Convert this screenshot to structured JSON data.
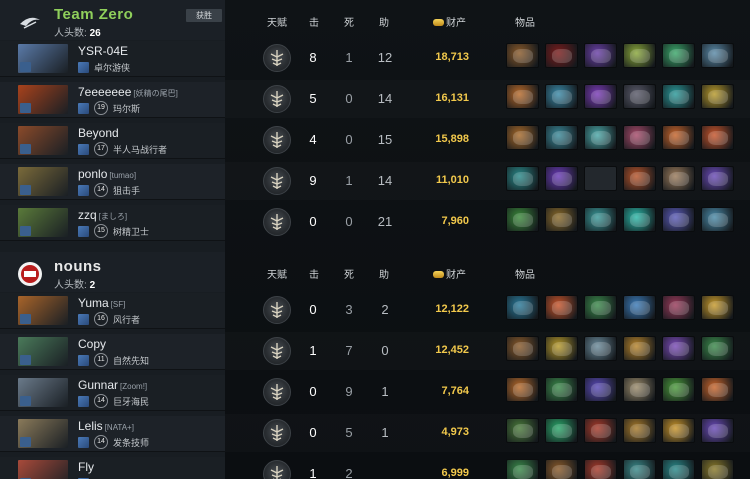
{
  "headers": {
    "talent": "天赋",
    "kills": "击",
    "deaths": "死",
    "assists": "助",
    "networth": "财产",
    "items": "物品"
  },
  "teams": [
    {
      "name": "Team Zero",
      "kills_label": "人头数:",
      "kills": "26",
      "win_badge": "获胜",
      "players": [
        {
          "name": "YSR-04E",
          "tag": "",
          "level": "",
          "rank": "",
          "hero": "卓尔游侠",
          "portrait": "#5a7aa8",
          "k": "8",
          "d": "1",
          "a": "12",
          "gold": "18,713",
          "items": [
            "#8a5a2a",
            "#7a1c1c",
            "#6a3fa8",
            "#8aa83a",
            "#3aa86a",
            "#5a8aa8"
          ]
        },
        {
          "name": "7eeeeeee",
          "tag": "[妖精の尾巴]",
          "level": "",
          "rank": "19",
          "hero": "玛尔斯",
          "portrait": "#a8421c",
          "k": "5",
          "d": "0",
          "a": "14",
          "gold": "16,131",
          "items": [
            "#b86a2a",
            "#3a8aa8",
            "#7a3ab8",
            "#5a5a6a",
            "#2a9a9a",
            "#b89a2a"
          ]
        },
        {
          "name": "Beyond",
          "tag": "",
          "level": "",
          "rank": "17",
          "hero": "半人马战行者",
          "portrait": "#8a4a2a",
          "k": "4",
          "d": "0",
          "a": "15",
          "gold": "15,898",
          "items": [
            "#a86a2a",
            "#3a8a9a",
            "#4aa8a8",
            "#a84a6a",
            "#c8642a",
            "#c8542a"
          ]
        },
        {
          "name": "ponlo",
          "tag": "[tumao]",
          "level": "",
          "rank": "14",
          "hero": "狙击手",
          "portrait": "#7a6a3a",
          "k": "9",
          "d": "1",
          "a": "14",
          "gold": "11,010",
          "items": [
            "#2a8a8a",
            "#6a3ab8",
            "",
            "#b8542a",
            "#9a7a5a",
            "#6a4ab8"
          ]
        },
        {
          "name": "zzq",
          "tag": "[ましろ]",
          "level": "",
          "rank": "15",
          "hero": "树精卫士",
          "portrait": "#5a7a3a",
          "k": "0",
          "d": "0",
          "a": "21",
          "gold": "7,960",
          "items": [
            "#3a8a3a",
            "#8a6a2a",
            "#3a9a9a",
            "#2ab8a8",
            "#5a5ab8",
            "#4a8aa8"
          ]
        }
      ]
    },
    {
      "name": "nouns",
      "kills_label": "人头数:",
      "kills": "2",
      "win_badge": "",
      "players": [
        {
          "name": "Yuma",
          "tag": "[SF]",
          "level": "",
          "rank": "16",
          "hero": "风行者",
          "portrait": "#a8642a",
          "k": "0",
          "d": "3",
          "a": "2",
          "gold": "12,122",
          "items": [
            "#2a7a9a",
            "#c8542a",
            "#3a8a4a",
            "#3a7ab8",
            "#9a3a5a",
            "#c89a2a"
          ]
        },
        {
          "name": "Copy",
          "tag": "",
          "level": "",
          "rank": "11",
          "hero": "自然先知",
          "portrait": "#4a7a5a",
          "k": "1",
          "d": "7",
          "a": "0",
          "gold": "12,452",
          "items": [
            "#8a5a2a",
            "#b89a2a",
            "#6a8a9a",
            "#b8842a",
            "#7a4ab8",
            "#3a8a4a"
          ]
        },
        {
          "name": "Gunnar",
          "tag": "[Zoom!]",
          "level": "",
          "rank": "14",
          "hero": "巨牙海民",
          "portrait": "#6a7a8a",
          "k": "0",
          "d": "9",
          "a": "1",
          "gold": "7,764",
          "items": [
            "#b86a2a",
            "#3a8a4a",
            "#5a4ab8",
            "#9a8a6a",
            "#4a9a3a",
            "#c8642a"
          ]
        },
        {
          "name": "Lelis",
          "tag": "[NATA+]",
          "level": "",
          "rank": "14",
          "hero": "发条技师",
          "portrait": "#8a7a5a",
          "k": "0",
          "d": "5",
          "a": "1",
          "gold": "4,973",
          "items": [
            "#4a7a3a",
            "#2aa86a",
            "#a83a2a",
            "#a87a2a",
            "#c8942a",
            "#6a4ab8"
          ]
        },
        {
          "name": "Fly",
          "tag": "",
          "level": "",
          "rank": "",
          "hero": "",
          "portrait": "#a84a3a",
          "k": "1",
          "d": "2",
          "a": "",
          "gold": "6,999",
          "items": [
            "#3a8a4a",
            "#8a5a2a",
            "#a83a2a",
            "#3a8a8a",
            "#2a8a8a",
            "#8a7a2a"
          ]
        }
      ]
    }
  ]
}
